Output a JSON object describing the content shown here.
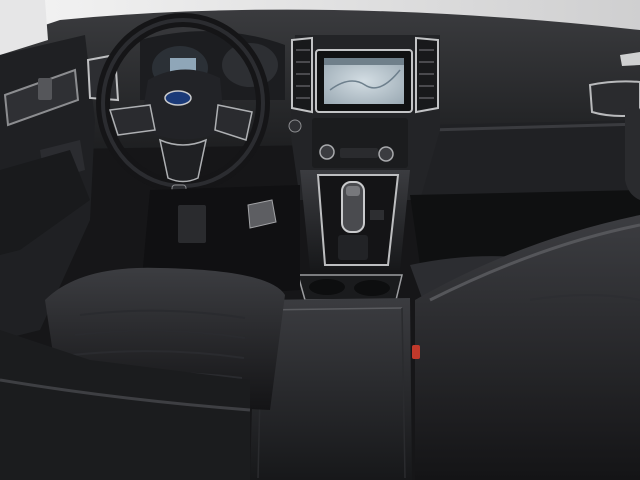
{
  "photo": {
    "subject": "",
    "colors": {
      "interior_dark": "#1b1c1e",
      "dash_top": "#2a2b2e",
      "trim_silver": "#c9cacc",
      "screen_map": "#b8c6cf",
      "window_light": "#e9e9ea",
      "leather_highlight": "#4a4b4f",
      "accent_red": "#c0392b"
    },
    "icons": [
      "ford-logo-icon"
    ]
  }
}
